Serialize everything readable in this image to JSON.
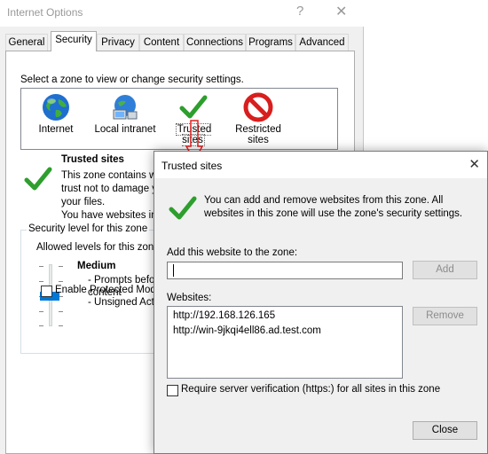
{
  "back_window": {
    "title": "Internet Options",
    "help_glyph": "?",
    "close_glyph": "✕",
    "tabs": [
      {
        "label": "General",
        "active": false
      },
      {
        "label": "Security",
        "active": true
      },
      {
        "label": "Privacy",
        "active": false
      },
      {
        "label": "Content",
        "active": false
      },
      {
        "label": "Connections",
        "active": false
      },
      {
        "label": "Programs",
        "active": false
      },
      {
        "label": "Advanced",
        "active": false
      }
    ],
    "zone_prompt": "Select a zone to view or change security settings.",
    "zones": [
      {
        "label": "Internet",
        "icon": "globe-icon"
      },
      {
        "label": "Local intranet",
        "icon": "intranet-icon"
      },
      {
        "label": "Trusted sites",
        "icon": "checkmark-icon",
        "selected": true
      },
      {
        "label": "Restricted sites",
        "label_line1": "Restricted",
        "label_line2": "sites",
        "icon": "blocked-icon"
      }
    ],
    "selected_zone": {
      "name": "Trusted sites",
      "desc_line1": "This zone contains we",
      "desc_line2": "trust not to damage y",
      "desc_line3": "your files.",
      "desc_line4": "You have websites in"
    },
    "security_level": {
      "legend": "Security level for this zone",
      "allowed": "Allowed levels for this zone",
      "level_name": "Medium",
      "desc1_line1": "- Prompts befor",
      "desc1_line2": "content",
      "desc2": "- Unsigned Activ",
      "slider_level": "Medium"
    },
    "protected_mode": {
      "label": "Enable Protected Mode",
      "checked": false
    }
  },
  "dialog": {
    "title": "Trusted sites",
    "close_glyph": "✕",
    "info": "You can add and remove websites from this zone. All websites in this zone will use the zone's security settings.",
    "add_label": "Add this website to the zone:",
    "add_input_value": "",
    "add_button": "Add",
    "websites_label": "Websites:",
    "websites": [
      "http://192.168.126.165",
      "http://win-9jkqi4ell86.ad.test.com"
    ],
    "remove_button": "Remove",
    "https_label": "Require server verification (https:) for all sites in this zone",
    "https_checked": false,
    "close_button": "Close"
  },
  "colors": {
    "accent": "#0078d7",
    "check_green": "#2e9e2e",
    "blocked_red": "#d81e1e",
    "arrow_red": "#e02020"
  }
}
